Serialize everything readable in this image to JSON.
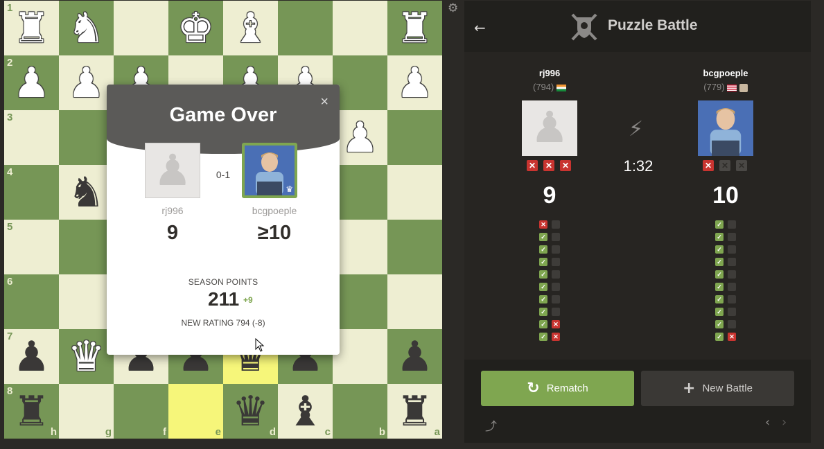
{
  "board": {
    "squares": [
      [
        "wR",
        "wN",
        "",
        "wK",
        "wB",
        "",
        "",
        "wR"
      ],
      [
        "wP",
        "wP",
        "wP",
        "",
        "wP",
        "wP",
        "",
        "wP"
      ],
      [
        "",
        "",
        "",
        "",
        "",
        "",
        "wP",
        ""
      ],
      [
        "",
        "bN",
        "",
        "",
        "",
        "",
        "",
        ""
      ],
      [
        "",
        "",
        "",
        "",
        "",
        "",
        "",
        ""
      ],
      [
        "",
        "",
        "",
        "",
        "",
        "",
        "",
        ""
      ],
      [
        "bP",
        "wQ",
        "bP",
        "bP",
        "bQ",
        "bP",
        "",
        "bP"
      ],
      [
        "bR",
        "",
        "",
        "",
        "bQ",
        "bB",
        "",
        "bR"
      ]
    ],
    "rank_labels": [
      "1",
      "2",
      "3",
      "4",
      "5",
      "6",
      "7",
      "8"
    ],
    "file_labels": [
      "h",
      "g",
      "f",
      "e",
      "d",
      "c",
      "b",
      "a"
    ],
    "highlighted": [
      "6-4",
      "7-3"
    ]
  },
  "pieces": {
    "wK": "♚",
    "wQ": "♛",
    "wR": "♜",
    "wB": "♝",
    "wN": "♞",
    "wP": "♟",
    "bK": "♚",
    "bQ": "♛",
    "bR": "♜",
    "bB": "♝",
    "bN": "♞",
    "bP": "♟"
  },
  "modal": {
    "title": "Game Over",
    "close": "×",
    "result": "0-1",
    "player1": {
      "name": "rj996",
      "score": "9"
    },
    "player2": {
      "name": "bcgpoeple",
      "score": "≥10"
    },
    "season_label": "SEASON POINTS",
    "season_points": "211",
    "season_delta": "+9",
    "new_rating": "NEW RATING 794 (-8)"
  },
  "panel": {
    "title": "Puzzle Battle",
    "back_icon": "arrow-left-icon",
    "player1": {
      "name": "rj996",
      "rating": "(794)",
      "score": "9",
      "strikes": [
        true,
        true,
        true
      ]
    },
    "player2": {
      "name": "bcgpoeple",
      "rating": "(779)",
      "score": "10",
      "strikes": [
        true,
        false,
        false
      ]
    },
    "timer": "1:32",
    "results1": [
      [
        "bad",
        "empty"
      ],
      [
        "ok",
        "empty"
      ],
      [
        "ok",
        "empty"
      ],
      [
        "ok",
        "empty"
      ],
      [
        "ok",
        "empty"
      ],
      [
        "ok",
        "empty"
      ],
      [
        "ok",
        "empty"
      ],
      [
        "ok",
        "empty"
      ],
      [
        "ok",
        "bad"
      ],
      [
        "ok",
        "bad"
      ]
    ],
    "results2": [
      [
        "ok",
        "empty"
      ],
      [
        "ok",
        "empty"
      ],
      [
        "ok",
        "empty"
      ],
      [
        "ok",
        "empty"
      ],
      [
        "ok",
        "empty"
      ],
      [
        "ok",
        "empty"
      ],
      [
        "ok",
        "empty"
      ],
      [
        "ok",
        "empty"
      ],
      [
        "ok",
        "empty"
      ],
      [
        "ok",
        "bad"
      ]
    ],
    "rematch_label": "Rematch",
    "new_battle_label": "New Battle"
  },
  "colors": {
    "accent": "#7fa650",
    "strike": "#c93430",
    "light": "#eeeed2",
    "dark": "#769656",
    "highlight": "#f6f67a"
  }
}
